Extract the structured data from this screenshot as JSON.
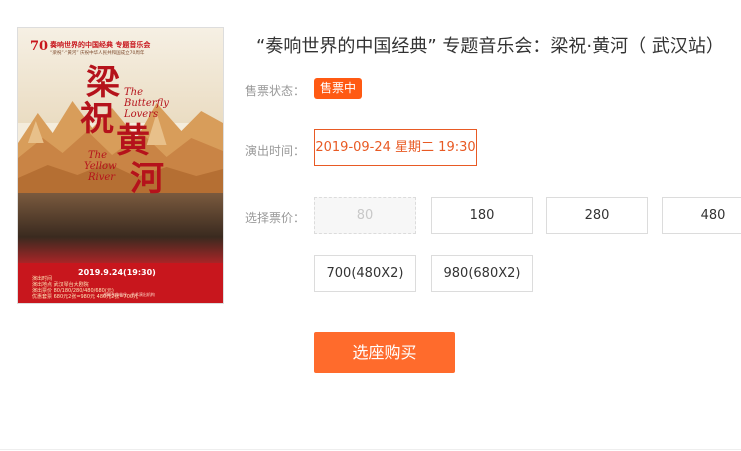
{
  "poster": {
    "logo_text": "70",
    "head_line1": "奏响世界的中国经典 专题音乐会",
    "head_line2": "“梁祝”·“黄河” 庆祝中华人民共和国成立70周年",
    "title_cn_1": "梁",
    "title_cn_2": "祝",
    "title_cn_3": "黄",
    "title_cn_4": "河",
    "title_en_1": "The",
    "title_en_2": "Butterfly",
    "title_en_3": "Lovers",
    "title_en_4": "The",
    "title_en_5": "Yellow",
    "title_en_6": "River",
    "date_text": "2019.9.24(19:30)",
    "info_line1": "演出时间",
    "info_line2": "演出地点  武汉琴台大剧院",
    "info_line3": "演出票价  80/180/280/480/680(元)",
    "info_line4": "优惠套票  680元2张=980元  480元2张=700元",
    "footer_text": "战略合作单位 · 艺术演出机构"
  },
  "product": {
    "title": "“奏响世界的中国经典” 专题音乐会：梁祝·黄河（ 武汉站）"
  },
  "status": {
    "label": "售票状态：",
    "value": "售票中"
  },
  "showtime": {
    "label": "演出时间：",
    "options": [
      "2019-09-24 星期二 19:30"
    ],
    "selected_index": 0
  },
  "price": {
    "label": "选择票价：",
    "options": [
      "80",
      "180",
      "280",
      "480",
      "700(480X2)",
      "980(680X2)"
    ],
    "disabled": [
      "80"
    ]
  },
  "buy_button": {
    "label": "选座购买"
  },
  "colors": {
    "accent": "#ff6b2c",
    "badge": "#ff5a13",
    "selected_border": "#e85a24",
    "poster_red": "#c8161d"
  }
}
